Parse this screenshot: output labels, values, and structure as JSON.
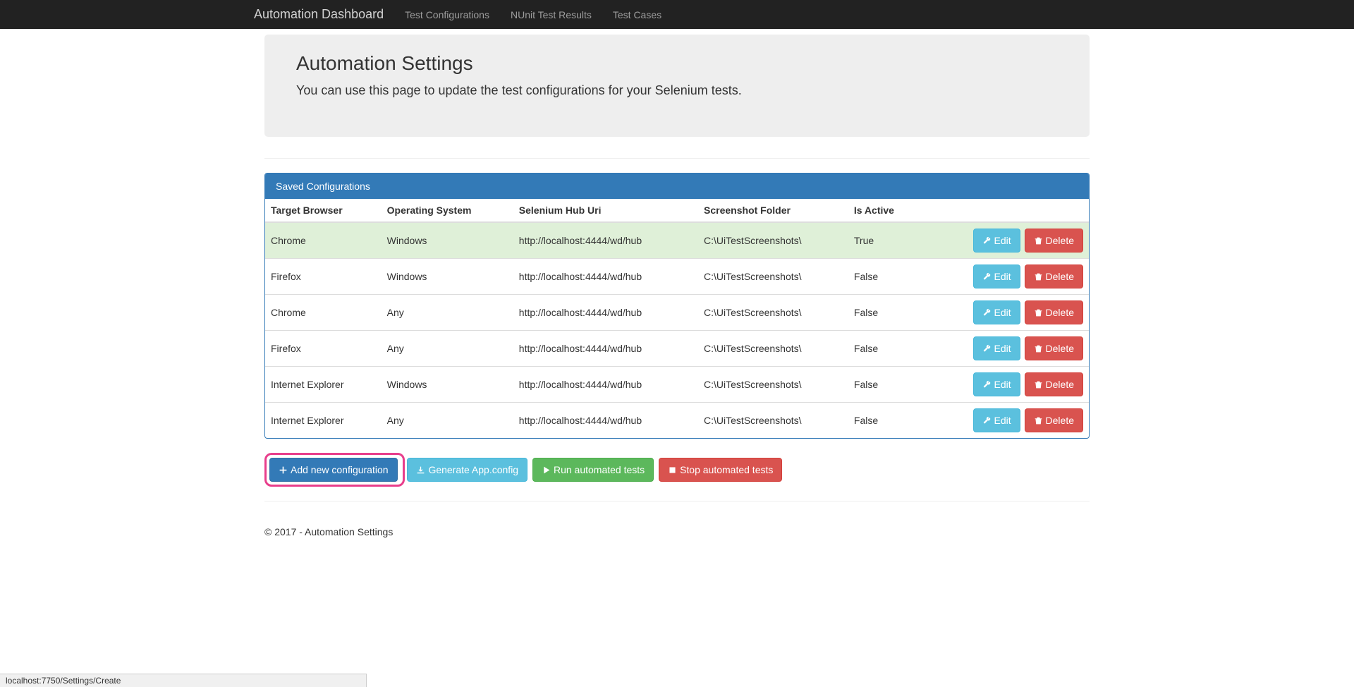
{
  "navbar": {
    "brand": "Automation Dashboard",
    "links": [
      "Test Configurations",
      "NUnit Test Results",
      "Test Cases"
    ]
  },
  "jumbotron": {
    "title": "Automation Settings",
    "subtitle": "You can use this page to update the test configurations for your Selenium tests."
  },
  "panel": {
    "heading": "Saved Configurations",
    "columns": [
      "Target Browser",
      "Operating System",
      "Selenium Hub Uri",
      "Screenshot Folder",
      "Is Active"
    ],
    "rows": [
      {
        "browser": "Chrome",
        "os": "Windows",
        "hub": "http://localhost:4444/wd/hub",
        "folder": "C:\\UiTestScreenshots\\",
        "active": "True",
        "success": true
      },
      {
        "browser": "Firefox",
        "os": "Windows",
        "hub": "http://localhost:4444/wd/hub",
        "folder": "C:\\UiTestScreenshots\\",
        "active": "False",
        "success": false
      },
      {
        "browser": "Chrome",
        "os": "Any",
        "hub": "http://localhost:4444/wd/hub",
        "folder": "C:\\UiTestScreenshots\\",
        "active": "False",
        "success": false
      },
      {
        "browser": "Firefox",
        "os": "Any",
        "hub": "http://localhost:4444/wd/hub",
        "folder": "C:\\UiTestScreenshots\\",
        "active": "False",
        "success": false
      },
      {
        "browser": "Internet Explorer",
        "os": "Windows",
        "hub": "http://localhost:4444/wd/hub",
        "folder": "C:\\UiTestScreenshots\\",
        "active": "False",
        "success": false
      },
      {
        "browser": "Internet Explorer",
        "os": "Any",
        "hub": "http://localhost:4444/wd/hub",
        "folder": "C:\\UiTestScreenshots\\",
        "active": "False",
        "success": false
      }
    ],
    "edit_label": "Edit",
    "delete_label": "Delete"
  },
  "actions": {
    "add": "Add new configuration",
    "generate": "Generate App.config",
    "run": "Run automated tests",
    "stop": "Stop automated tests"
  },
  "footer": "© 2017 - Automation Settings",
  "status_bar": "localhost:7750/Settings/Create"
}
